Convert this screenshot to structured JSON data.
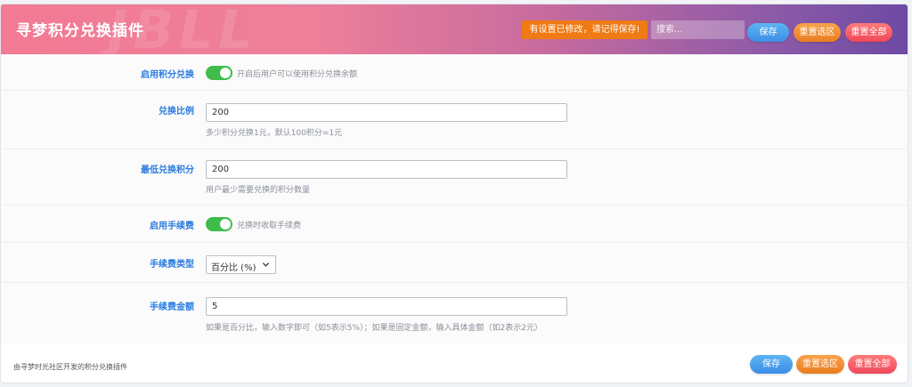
{
  "header": {
    "title": "寻梦积分兑换插件",
    "watermark": "JBLL",
    "warning": "有设置已修改，请记得保存!",
    "search_placeholder": "搜索...",
    "save_label": "保存",
    "reset_section_label": "重置选区",
    "reset_all_label": "重置全部"
  },
  "fields": {
    "enable_exchange": {
      "label": "启用积分兑换",
      "enabled": true,
      "description": "开启后用户可以使用积分兑换余额"
    },
    "exchange_ratio": {
      "label": "兑换比例",
      "value": "200",
      "help": "多少积分兑换1元，默认100积分=1元"
    },
    "min_points": {
      "label": "最低兑换积分",
      "value": "200",
      "help": "用户最少需要兑换的积分数量"
    },
    "enable_fee": {
      "label": "启用手续费",
      "enabled": true,
      "description": "兑换时收取手续费"
    },
    "fee_type": {
      "label": "手续费类型",
      "selected": "百分比 (%)"
    },
    "fee_amount": {
      "label": "手续费金额",
      "value": "5",
      "help": "如果是百分比，输入数字即可（如5表示5%）；如果是固定金额，输入具体金额（如2表示2元）"
    }
  },
  "footer": {
    "text": "由寻梦时光社区开发的积分兑换插件",
    "save_label": "保存",
    "reset_section_label": "重置选区",
    "reset_all_label": "重置全部"
  },
  "colors": {
    "accent_blue": "#2a7be0",
    "toggle_on": "#3fbc4c",
    "warning_orange": "#f07a14"
  }
}
